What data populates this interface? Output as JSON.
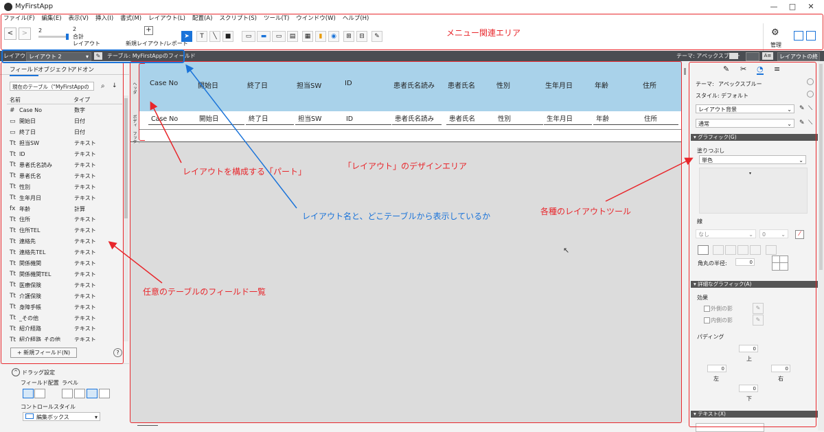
{
  "window": {
    "title": "MyFirstApp",
    "controls": [
      "—",
      "□",
      "✕"
    ]
  },
  "menubar": [
    "ファイル(F)",
    "編集(E)",
    "表示(V)",
    "挿入(I)",
    "書式(M)",
    "レイアウト(L)",
    "配置(A)",
    "スクリプト(S)",
    "ツール(T)",
    "ウインドウ(W)",
    "ヘルプ(H)"
  ],
  "toolbar": {
    "nav_back": "<",
    "nav_forward": ">",
    "slider_value": "2",
    "record_count": "2",
    "total_label": "合計",
    "layout_label": "レイアウト",
    "new_layout_label": "新規レイアウト/レポート",
    "manage_label": "管理"
  },
  "layoutbar": {
    "layout_prefix": "レイアウト:",
    "layout_name": "レイアウト 2",
    "table_text": "テーブル: MyFirstAppのフィールド",
    "theme_text": "テーマ: アペックスブルー",
    "aa_label": "A≡",
    "exit_button": "レイアウトの終了"
  },
  "left_pane": {
    "tabs": [
      "フィールド",
      "オブジェクト",
      "アドオン"
    ],
    "table_select": "現在のテーブル（\"MyFirstAppの",
    "col_name": "名前",
    "col_type": "タイプ",
    "fields": [
      {
        "icon": "#",
        "name": "Case No",
        "type": "数字"
      },
      {
        "icon": "▭",
        "name": "開始日",
        "type": "日付"
      },
      {
        "icon": "▭",
        "name": "終了日",
        "type": "日付"
      },
      {
        "icon": "Tt",
        "name": "担当SW",
        "type": "テキスト"
      },
      {
        "icon": "Tt",
        "name": "ID",
        "type": "テキスト"
      },
      {
        "icon": "Tt",
        "name": "患者氏名読み",
        "type": "テキスト"
      },
      {
        "icon": "Tt",
        "name": "患者氏名",
        "type": "テキスト"
      },
      {
        "icon": "Tt",
        "name": "性別",
        "type": "テキスト"
      },
      {
        "icon": "Tt",
        "name": "生年月日",
        "type": "テキスト"
      },
      {
        "icon": "fx",
        "name": "年齢",
        "type": "計算"
      },
      {
        "icon": "Tt",
        "name": "住所",
        "type": "テキスト"
      },
      {
        "icon": "Tt",
        "name": "住所TEL",
        "type": "テキスト"
      },
      {
        "icon": "Tt",
        "name": "連絡先",
        "type": "テキスト"
      },
      {
        "icon": "Tt",
        "name": "連絡先TEL",
        "type": "テキスト"
      },
      {
        "icon": "Tt",
        "name": "関係機関",
        "type": "テキスト"
      },
      {
        "icon": "Tt",
        "name": "関係機関TEL",
        "type": "テキスト"
      },
      {
        "icon": "Tt",
        "name": "医療保険",
        "type": "テキスト"
      },
      {
        "icon": "Tt",
        "name": "介護保険",
        "type": "テキスト"
      },
      {
        "icon": "Tt",
        "name": "身障手帳",
        "type": "テキスト"
      },
      {
        "icon": "Tt",
        "name": "_その他",
        "type": "テキスト"
      },
      {
        "icon": "Tt",
        "name": "紹介経路",
        "type": "テキスト"
      },
      {
        "icon": "Tt",
        "name": "紹介経路_その他",
        "type": "テキスト"
      }
    ],
    "new_field_button": "新規フィールド(N)",
    "help_icon": "?",
    "drag_settings": "ドラッグ設定",
    "field_placement": "フィールド配置",
    "label": "ラベル",
    "control_style": "コントロールスタイル",
    "control_value": "編集ボックス"
  },
  "design": {
    "part_header": "ヘッダ",
    "part_body": "ボディ",
    "part_footer": "フッタ",
    "header_labels": [
      "Case No",
      "開始日",
      "終了日",
      "担当SW",
      "ID",
      "患者氏名読み",
      "患者氏名",
      "性別",
      "生年月日",
      "年齢",
      "住所"
    ],
    "body_fields": [
      "Case No",
      "開始日",
      "終了日",
      "担当SW",
      "ID",
      "患者氏名読み",
      "患者氏名",
      "性別",
      "生年月日",
      "年齢",
      "住所"
    ]
  },
  "right_pane": {
    "theme_label": "テーマ:",
    "theme_value": "アペックスブルー",
    "style_label": "スタイル:",
    "style_value": "デフォルト",
    "select1": "レイアウト背景",
    "select2": "通常",
    "graphic_header": "グラフィック(G)",
    "fill_label": "塗りつぶし",
    "fill_value": "単色",
    "line_label": "線",
    "line_value": "なし",
    "line_width": "0",
    "radius_label": "角丸の半径:",
    "radius_value": "0",
    "adv_graphic_header": "詳細なグラフィック(A)",
    "effects_label": "効果",
    "outer_shadow": "外側の影",
    "inner_shadow": "内側の影",
    "padding_label": "パディング",
    "pad_top": "0",
    "pad_left": "0",
    "pad_right": "0",
    "pad_bottom": "0",
    "top_label": "上",
    "left_label": "左",
    "right_label": "右",
    "bottom_label": "下",
    "text_header": "テキスト(X)"
  },
  "annotations": {
    "menu_area": "メニュー関連エリア",
    "layout_design": "「レイアウト」のデザインエリア",
    "parts": "レイアウトを構成する「パート」",
    "layout_name": "レイアウト名と、どこテーブルから表示しているか",
    "tools": "各種のレイアウトツール",
    "fields_list": "任意のテーブルのフィールド一覧"
  },
  "colors": {
    "header_band": "#a9d2ea",
    "dark_bar": "#4a4d52",
    "annotation_red": "#e8262b",
    "annotation_blue": "#1a73d9",
    "accent": "#1a73d9"
  }
}
